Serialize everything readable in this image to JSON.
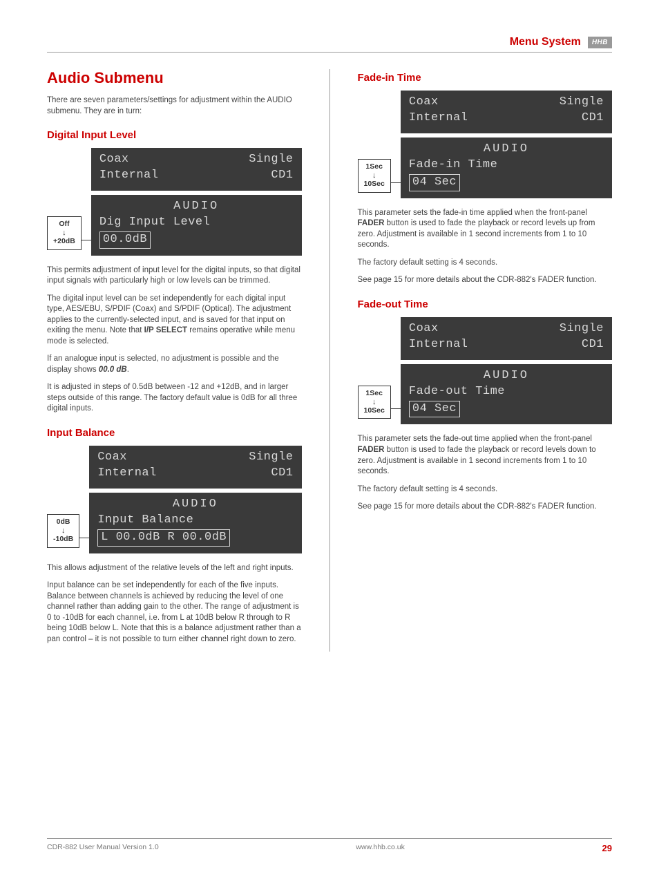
{
  "header": {
    "section_title": "Menu System",
    "brand": "HHB"
  },
  "left": {
    "h1": "Audio Submenu",
    "intro": "There are seven parameters/settings for adjustment within the AUDIO submenu. They are in turn:",
    "digital_input": {
      "heading": "Digital Input Level",
      "range_top": "Off",
      "range_bottom": "+20dB",
      "lcd_top_left": "Coax\nInternal",
      "lcd_top_right": "Single\nCD1",
      "lcd_menu": "AUDIO",
      "lcd_param": "Dig Input Level",
      "lcd_value": "00.0dB",
      "p1": "This permits adjustment of input level for the digital inputs, so that digital input signals with particularly high or low levels can be trimmed.",
      "p2_a": "The digital input level can be set independently for each digital input type, AES/EBU, S/PDIF (Coax) and S/PDIF (Optical). The adjustment applies to the currently-selected input, and is saved for that input on exiting the menu. Note that ",
      "p2_b_bold": "I/P SELECT",
      "p2_c": " remains operative while menu mode is selected.",
      "p3_a": "If an analogue input is selected, no adjustment is possible and the display shows ",
      "p3_b_emph": "00.0 dB",
      "p3_c": ".",
      "p4": "It is adjusted in steps of 0.5dB between -12 and +12dB, and in larger steps outside of this range. The factory default value is 0dB for all three digital inputs."
    },
    "input_balance": {
      "heading": "Input Balance",
      "range_top": "0dB",
      "range_bottom": "-10dB",
      "lcd_top_left": "Coax\nInternal",
      "lcd_top_right": "Single\nCD1",
      "lcd_menu": "AUDIO",
      "lcd_param": "Input Balance",
      "lcd_value": "L 00.0dB R 00.0dB",
      "p1": "This allows adjustment of the relative levels of the left and right inputs.",
      "p2": "Input balance can be set independently for each of the five inputs. Balance between channels is achieved by reducing the level of one channel rather than adding gain to the other. The range of adjustment is 0 to -10dB for each channel, i.e. from L at 10dB below R through to R being 10dB below L. Note that this is a balance adjustment rather than a pan control – it is not possible to turn either channel right down to zero."
    }
  },
  "right": {
    "fade_in": {
      "heading": "Fade-in Time",
      "range_top": "1Sec",
      "range_bottom": "10Sec",
      "lcd_top_left": "Coax\nInternal",
      "lcd_top_right": "Single\nCD1",
      "lcd_menu": "AUDIO",
      "lcd_param": "Fade-in Time",
      "lcd_value": "04 Sec",
      "p1_a": "This parameter sets the fade-in time applied when the front-panel ",
      "p1_b_bold": "FADER",
      "p1_c": " button is used to fade the playback or record levels up from zero. Adjustment is available in 1 second increments from 1 to 10 seconds.",
      "p2": "The factory default setting is 4 seconds.",
      "p3": "See page 15 for more details about the CDR-882's FADER function."
    },
    "fade_out": {
      "heading": "Fade-out Time",
      "range_top": "1Sec",
      "range_bottom": "10Sec",
      "lcd_top_left": "Coax\nInternal",
      "lcd_top_right": "Single\nCD1",
      "lcd_menu": "AUDIO",
      "lcd_param": "Fade-out Time",
      "lcd_value": "04 Sec",
      "p1_a": "This parameter sets the fade-out time applied when the front-panel ",
      "p1_b_bold": "FADER",
      "p1_c": " button is used to fade the playback or record levels down to zero. Adjustment is available in 1 second increments from 1 to 10 seconds.",
      "p2": "The factory default setting is 4 seconds.",
      "p3": "See page 15 for more details about the CDR-882's FADER function."
    }
  },
  "footer": {
    "left": "CDR-882 User Manual Version 1.0",
    "center": "www.hhb.co.uk",
    "page": "29"
  }
}
